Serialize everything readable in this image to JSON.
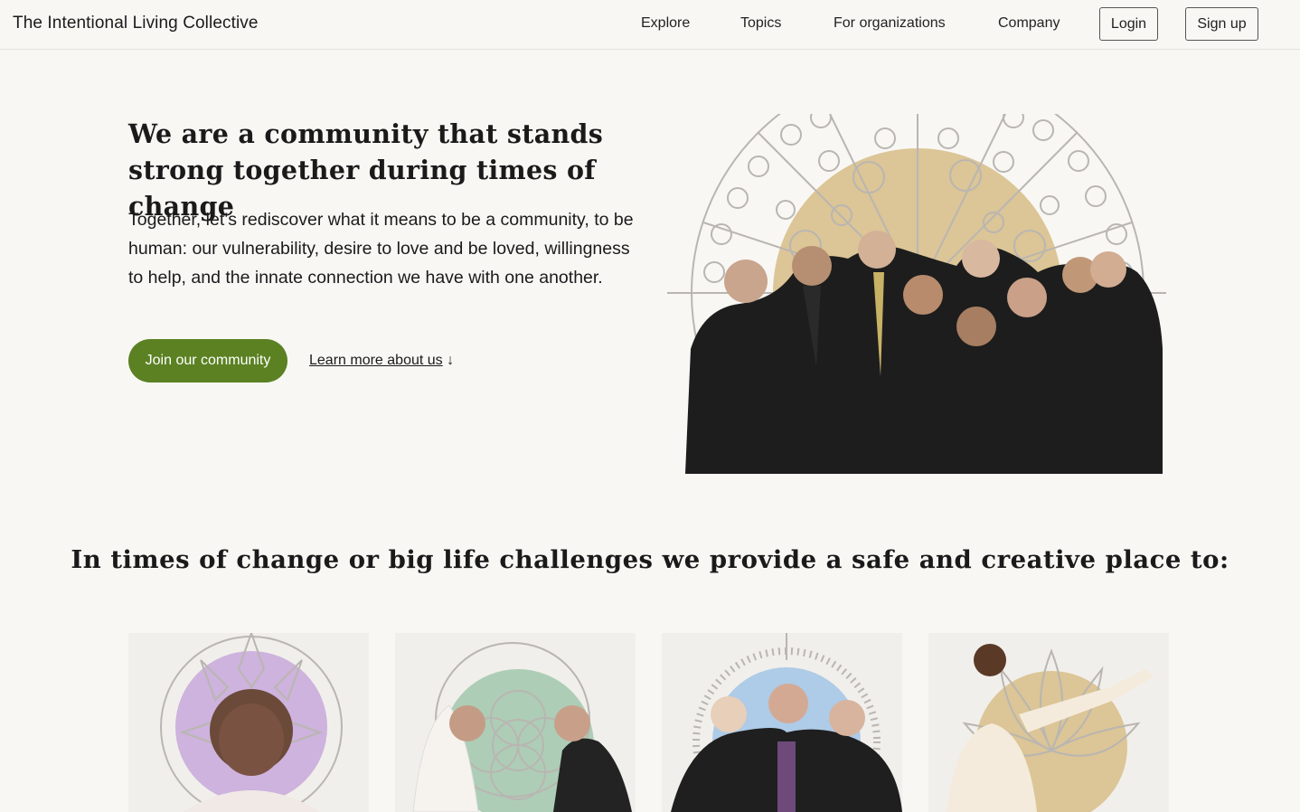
{
  "brand": "The Intentional Living Collective",
  "nav": {
    "links": [
      "Explore",
      "Topics",
      "For organizations",
      "Company"
    ],
    "login": "Login",
    "signup": "Sign up"
  },
  "hero": {
    "title": "We are a community that stands strong together during times of change",
    "body": "Together, let’s rediscover what it means to be a community, to be human: our vulnerability, desire to love and be loved, willingness to help, and the innate connection we have with one another.",
    "cta": "Join our community",
    "learn_more": "Learn more about us",
    "learn_more_arrow": "↓",
    "image_alt": "Group photo of community members in front of a gold mandala"
  },
  "section": {
    "title": "In times of change or big life challenges we provide a safe and creative place to:"
  },
  "colors": {
    "background": "#f8f7f4",
    "accent_green": "#5b8122",
    "gold": "#dcc596",
    "lavender": "#cdb3dd",
    "sage": "#adcdb7",
    "sky": "#aecbe7",
    "line": "#b9b6b1"
  },
  "icons": [
    "down-arrow-icon"
  ]
}
